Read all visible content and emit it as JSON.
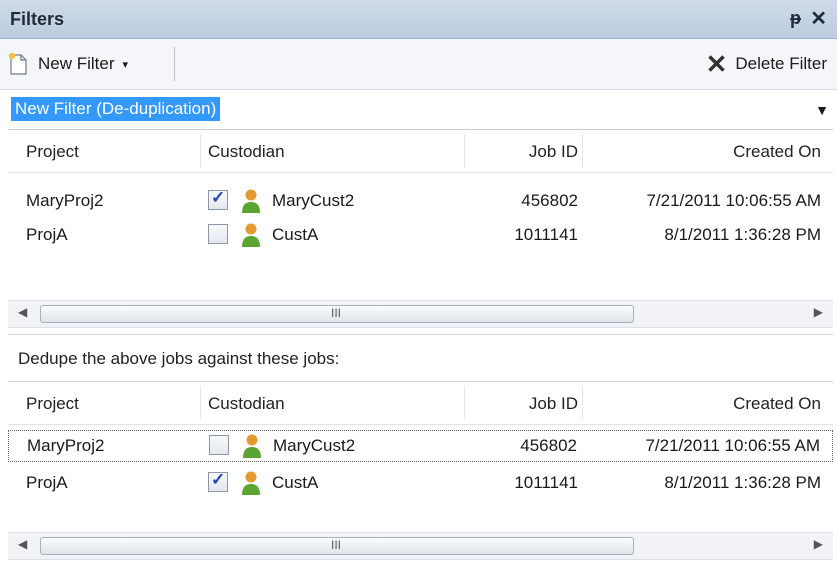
{
  "panel": {
    "title": "Filters",
    "pin_glyph": "ᵽ",
    "close_glyph": "✕"
  },
  "toolbar": {
    "new_filter_label": "New Filter",
    "new_filter_icon": "new-document-icon",
    "dropdown_glyph": "▾",
    "delete_filter_label": "Delete Filter",
    "delete_icon_glyph": "✕"
  },
  "filter_select": {
    "value": "New Filter (De-duplication)",
    "arrow_glyph": "▼"
  },
  "columns": [
    "Project",
    "Custodian",
    "Job ID",
    "Created On"
  ],
  "top_grid": {
    "rows": [
      {
        "project": "MaryProj2",
        "checked": true,
        "custodian": "MaryCust2",
        "job_id": "456802",
        "created_on": "7/21/2011 10:06:55 AM"
      },
      {
        "project": "ProjA",
        "checked": false,
        "custodian": "CustA",
        "job_id": "1011141",
        "created_on": "8/1/2011 1:36:28 PM"
      }
    ]
  },
  "dedupe_label": "Dedupe the above jobs against these jobs:",
  "bottom_grid": {
    "rows": [
      {
        "project": "MaryProj2",
        "checked": false,
        "custodian": "MaryCust2",
        "job_id": "456802",
        "created_on": "7/21/2011 10:06:55 AM"
      },
      {
        "project": "ProjA",
        "checked": true,
        "custodian": "CustA",
        "job_id": "1011141",
        "created_on": "8/1/2011 1:36:28 PM"
      }
    ]
  },
  "scrollbar": {
    "left_glyph": "◀",
    "right_glyph": "▶",
    "grip_glyph": "III"
  },
  "colors": {
    "selection": "#3399ff",
    "titlebar": "#c6d3e3",
    "person_icon": "#e39a2e"
  }
}
